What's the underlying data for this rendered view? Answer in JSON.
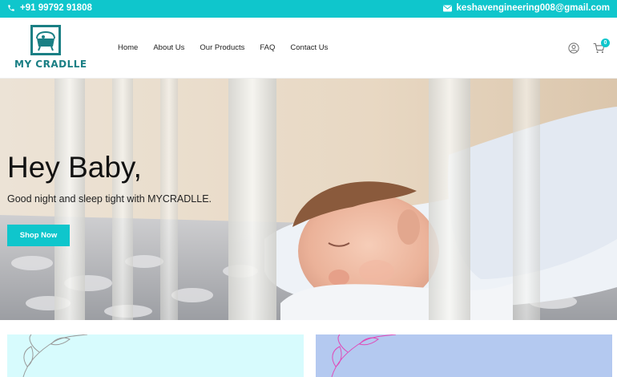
{
  "topbar": {
    "phone": "+91 99792 91808",
    "email": "keshavengineering008@gmail.com",
    "phone_icon": "phone-icon",
    "email_icon": "envelope-icon"
  },
  "header": {
    "logo_text": "MY CRADLLE",
    "nav": [
      "Home",
      "About Us",
      "Our Products",
      "FAQ",
      "Contact Us"
    ],
    "user_icon": "user-icon",
    "cart_icon": "cart-icon",
    "cart_count": "0"
  },
  "hero": {
    "title": "Hey Baby,",
    "subtitle": "Good night and sleep tight with MYCRADLLE.",
    "button": "Shop Now"
  },
  "colors": {
    "accent": "#0fc6cc",
    "logo": "#1a7f84",
    "card1_bg": "#d7fbfd",
    "card2_bg": "#b4c9f0"
  }
}
